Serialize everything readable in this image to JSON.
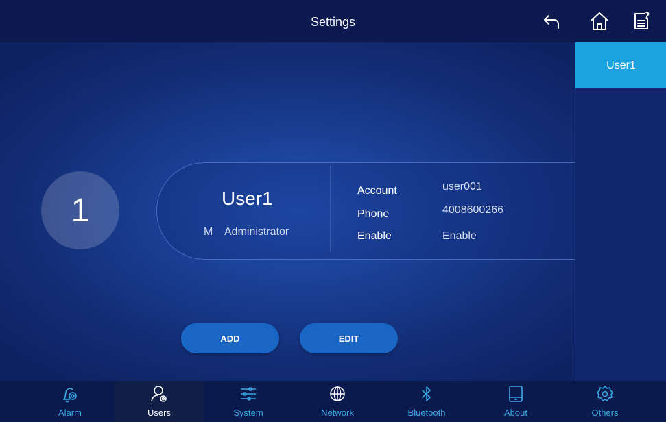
{
  "header": {
    "title": "Settings",
    "icons": [
      "back-arrow-icon",
      "home-icon",
      "notes-icon"
    ]
  },
  "user_list": {
    "items": [
      {
        "label": "User1",
        "selected": true
      }
    ]
  },
  "user_detail": {
    "index": "1",
    "name": "User1",
    "gender": "M",
    "role": "Administrator",
    "fields": [
      {
        "label": "Account",
        "value": "user001"
      },
      {
        "label": "Phone",
        "value": "4008600266"
      },
      {
        "label": "Enable",
        "value": "Enable"
      }
    ]
  },
  "actions": {
    "add_label": "ADD",
    "edit_label": "EDIT"
  },
  "nav": {
    "items": [
      {
        "label": "Alarm",
        "icon": "alarm-bell-icon"
      },
      {
        "label": "Users",
        "icon": "user-gear-icon",
        "active": true
      },
      {
        "label": "System",
        "icon": "sliders-icon"
      },
      {
        "label": "Network",
        "icon": "globe-icon"
      },
      {
        "label": "Bluetooth",
        "icon": "bluetooth-icon"
      },
      {
        "label": "About",
        "icon": "tablet-icon"
      },
      {
        "label": "Others",
        "icon": "gear-icon"
      }
    ]
  },
  "colors": {
    "accent": "#1ba3e0",
    "button": "#1966c4",
    "nav_label": "#3aa9e6",
    "background": "#122c74"
  }
}
